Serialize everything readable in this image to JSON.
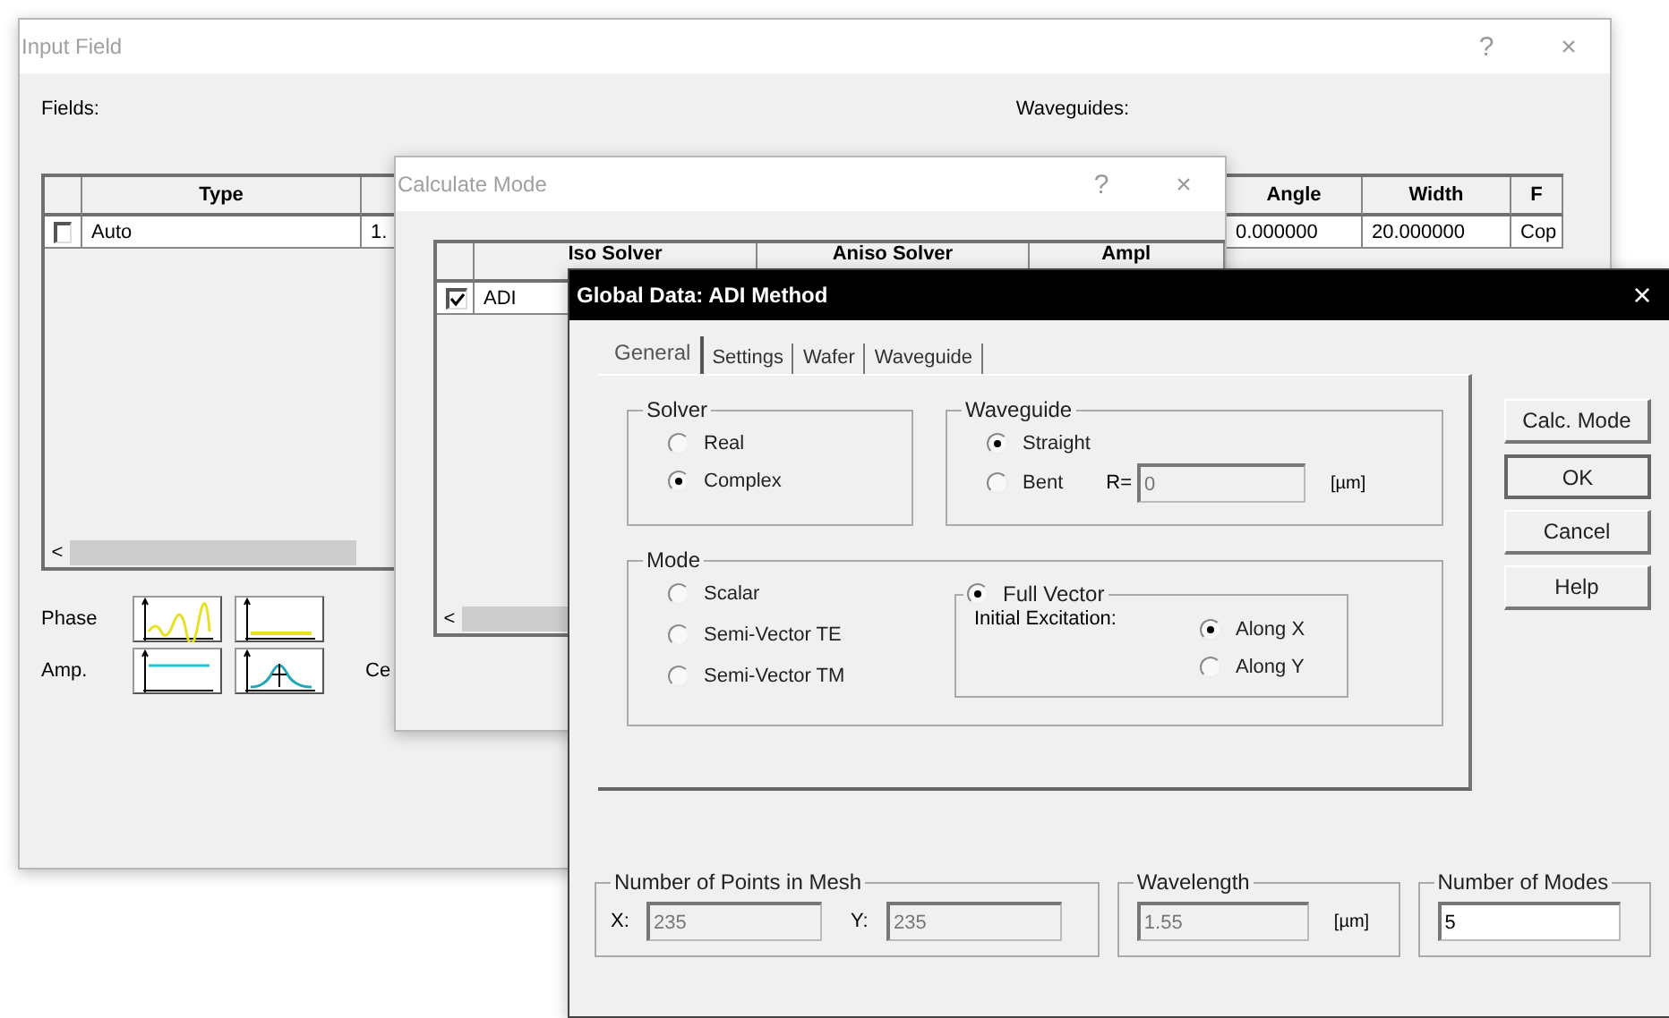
{
  "input_field_window": {
    "title": "Input Field",
    "help_button": "?",
    "close_button": "×",
    "fields_label": "Fields:",
    "waveguides_label": "Waveguides:",
    "fields_table": {
      "columns": [
        "Type"
      ],
      "rows": [
        {
          "checked": false,
          "cells": [
            "Auto",
            "1."
          ]
        }
      ],
      "scroll_arrow": "<"
    },
    "waveguides_table": {
      "columns": [
        "Angle",
        "Width",
        "F"
      ],
      "rows": [
        {
          "cells": [
            "0.000000",
            "20.000000",
            "Cop"
          ]
        }
      ]
    },
    "plot_rows": [
      {
        "label": "Phase",
        "plots": [
          {
            "kind": "phase-wave"
          },
          {
            "kind": "phase-flat"
          }
        ]
      },
      {
        "label": "Amp.",
        "plots": [
          {
            "kind": "amp-flat"
          },
          {
            "kind": "amp-peak"
          }
        ]
      }
    ],
    "cut_label": "Ce"
  },
  "calculate_mode_window": {
    "title": "Calculate Mode",
    "help_button": "?",
    "close_button": "×",
    "table": {
      "columns": [
        "Iso Solver",
        "Aniso Solver",
        "Ampl"
      ],
      "rows": [
        {
          "checked": true,
          "cells": [
            "ADI"
          ]
        }
      ]
    },
    "scroll_arrow": "<"
  },
  "global_window": {
    "title": "Global Data: ADI Method",
    "close_button": "×",
    "tabs": [
      {
        "label": "General",
        "selected": true
      },
      {
        "label": "Settings",
        "selected": false
      },
      {
        "label": "Wafer",
        "selected": false
      },
      {
        "label": "Waveguide",
        "selected": false
      }
    ],
    "solver": {
      "label": "Solver",
      "options": [
        {
          "label": "Real",
          "selected": false
        },
        {
          "label": "Complex",
          "selected": true
        }
      ]
    },
    "waveguide": {
      "label": "Waveguide",
      "options": [
        {
          "label": "Straight",
          "selected": true
        },
        {
          "label": "Bent",
          "selected": false
        }
      ],
      "radius": {
        "label": "R=",
        "value": "0",
        "unit": "[µm]",
        "disabled": true
      }
    },
    "mode": {
      "label": "Mode",
      "options": [
        {
          "label": "Scalar",
          "selected": false
        },
        {
          "label": "Semi-Vector TE",
          "selected": false
        },
        {
          "label": "Semi-Vector TM",
          "selected": false
        }
      ],
      "full_vector": {
        "label": "Full Vector",
        "selected": true,
        "excitation_label": "Initial Excitation:",
        "options": [
          {
            "label": "Along X",
            "selected": true
          },
          {
            "label": "Along Y",
            "selected": false
          }
        ]
      }
    },
    "buttons": [
      {
        "label": "Calc. Mode",
        "default": false
      },
      {
        "label": "OK",
        "default": true
      },
      {
        "label": "Cancel",
        "default": false
      },
      {
        "label": "Help",
        "default": false
      }
    ],
    "mesh": {
      "label": "Number of Points in Mesh",
      "x_label": "X:",
      "x_value": "235",
      "y_label": "Y:",
      "y_value": "235",
      "disabled": true
    },
    "wavelength": {
      "label": "Wavelength",
      "value": "1.55",
      "unit": "[µm]",
      "disabled": true
    },
    "modes": {
      "label": "Number of Modes",
      "value": "5",
      "disabled": false
    }
  }
}
